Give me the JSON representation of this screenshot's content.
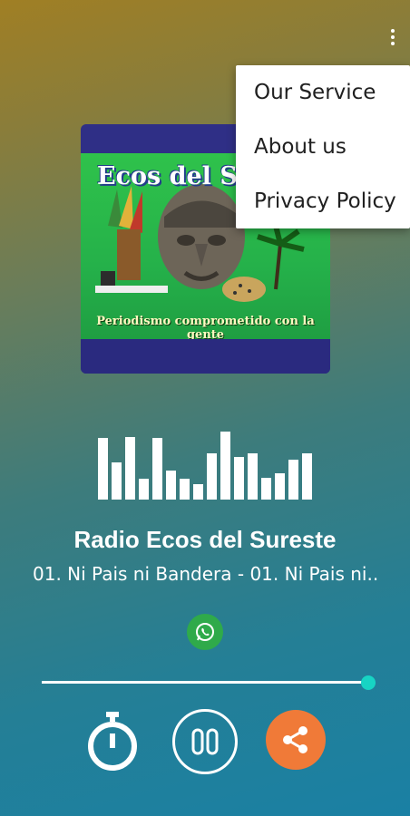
{
  "menu": {
    "items": [
      {
        "label": "Our Service"
      },
      {
        "label": "About us"
      },
      {
        "label": "Privacy Policy"
      }
    ]
  },
  "cover": {
    "title": "Ecos del S",
    "subtitle": "Periodismo comprometido con la gente"
  },
  "player": {
    "station": "Radio Ecos del Sureste",
    "track": "01. Ni Pais ni Bandera - 01. Ni Pais ni..",
    "progress": 1.0,
    "equalizer_levels": [
      0.9,
      0.55,
      0.92,
      0.3,
      0.9,
      0.42,
      0.3,
      0.22,
      0.68,
      1.0,
      0.62,
      0.68,
      0.32,
      0.38,
      0.58,
      0.68
    ]
  },
  "icons": {
    "overflow": "more-vertical-icon",
    "whatsapp": "whatsapp-icon",
    "timer": "stopwatch-icon",
    "pause": "pause-icon",
    "share": "share-icon"
  },
  "colors": {
    "accent": "#17d4c4",
    "share": "#f07a38",
    "whatsapp": "#2faa4a"
  }
}
